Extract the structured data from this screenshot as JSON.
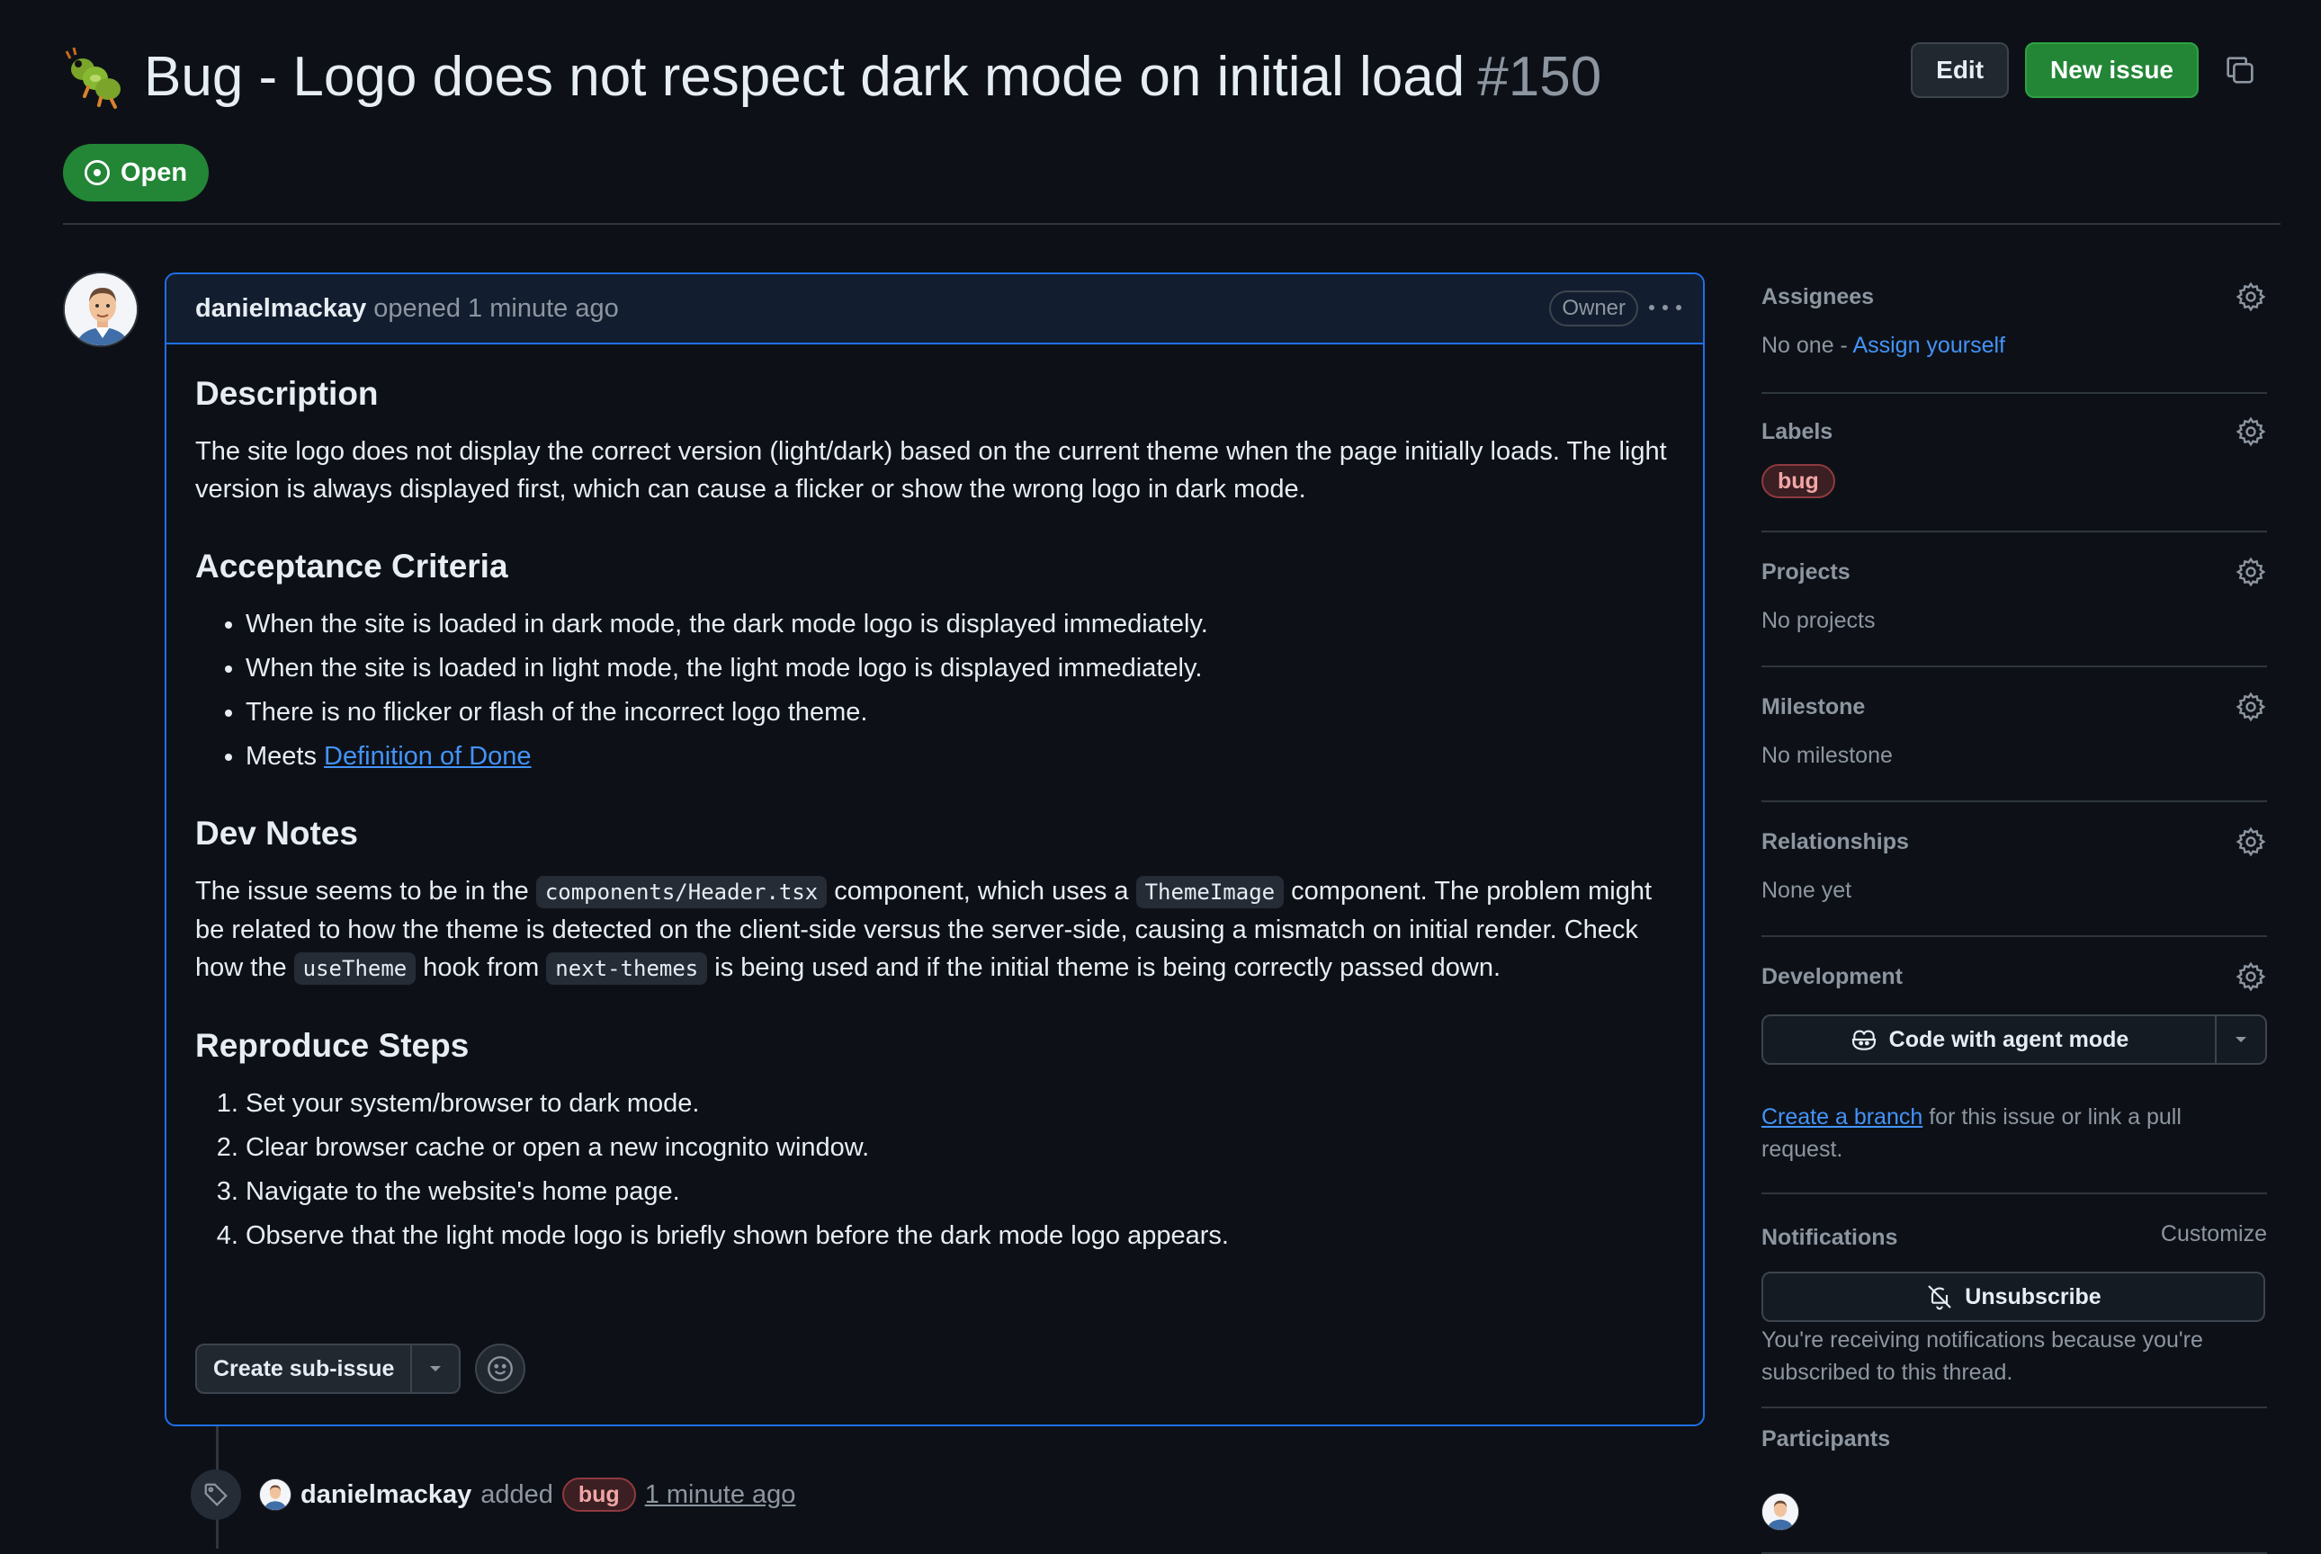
{
  "issue": {
    "title": "Bug - Logo does not respect dark mode on initial load",
    "number": "#150",
    "status": "Open"
  },
  "header_actions": {
    "edit_label": "Edit",
    "new_issue_label": "New issue"
  },
  "comment": {
    "author": "danielmackay",
    "meta": "opened 1 minute ago",
    "role_badge": "Owner",
    "description_heading": "Description",
    "description_text": "The site logo does not display the correct version (light/dark) based on the current theme when the page initially loads. The light version is always displayed first, which can cause a flicker or show the wrong logo in dark mode.",
    "acceptance_heading": "Acceptance Criteria",
    "acceptance_items": [
      "When the site is loaded in dark mode, the dark mode logo is displayed immediately.",
      "When the site is loaded in light mode, the light mode logo is displayed immediately.",
      "There is no flicker or flash of the incorrect logo theme."
    ],
    "acceptance_last_prefix": "Meets ",
    "acceptance_last_link": "Definition of Done",
    "devnotes_heading": "Dev Notes",
    "devnotes": {
      "t1": "The issue seems to be in the ",
      "c1": "components/Header.tsx",
      "t2": " component, which uses a ",
      "c2": "ThemeImage",
      "t3": " component. The problem might be related to how the theme is detected on the client-side versus the server-side, causing a mismatch on initial render. Check how the ",
      "c3": "useTheme",
      "t4": " hook from ",
      "c4": "next-themes",
      "t5": " is being used and if the initial theme is being correctly passed down."
    },
    "repro_heading": "Reproduce Steps",
    "repro_steps": [
      "Set your system/browser to dark mode.",
      "Clear browser cache or open a new incognito window.",
      "Navigate to the website's home page.",
      "Observe that the light mode logo is briefly shown before the dark mode logo appears."
    ],
    "create_subissue_label": "Create sub-issue"
  },
  "timeline": {
    "author": "danielmackay",
    "action": "added",
    "label": "bug",
    "time": "1 minute ago"
  },
  "sidebar": {
    "assignees": {
      "title": "Assignees",
      "text": "No one - ",
      "link": "Assign yourself"
    },
    "labels": {
      "title": "Labels",
      "label": "bug"
    },
    "projects": {
      "title": "Projects",
      "text": "No projects"
    },
    "milestone": {
      "title": "Milestone",
      "text": "No milestone"
    },
    "relationships": {
      "title": "Relationships",
      "text": "None yet"
    },
    "development": {
      "title": "Development",
      "button_label": "Code with agent mode",
      "link": "Create a branch",
      "text": " for this issue or link a pull request."
    },
    "notifications": {
      "title": "Notifications",
      "customize": "Customize",
      "button_label": "Unsubscribe",
      "text": "You're receiving notifications because you're subscribed to this thread."
    },
    "participants": {
      "title": "Participants"
    }
  },
  "colors": {
    "background": "#0d1117",
    "accent_blue": "#4493f8",
    "open_green": "#238636",
    "label_bug": "#f2a6a6"
  }
}
